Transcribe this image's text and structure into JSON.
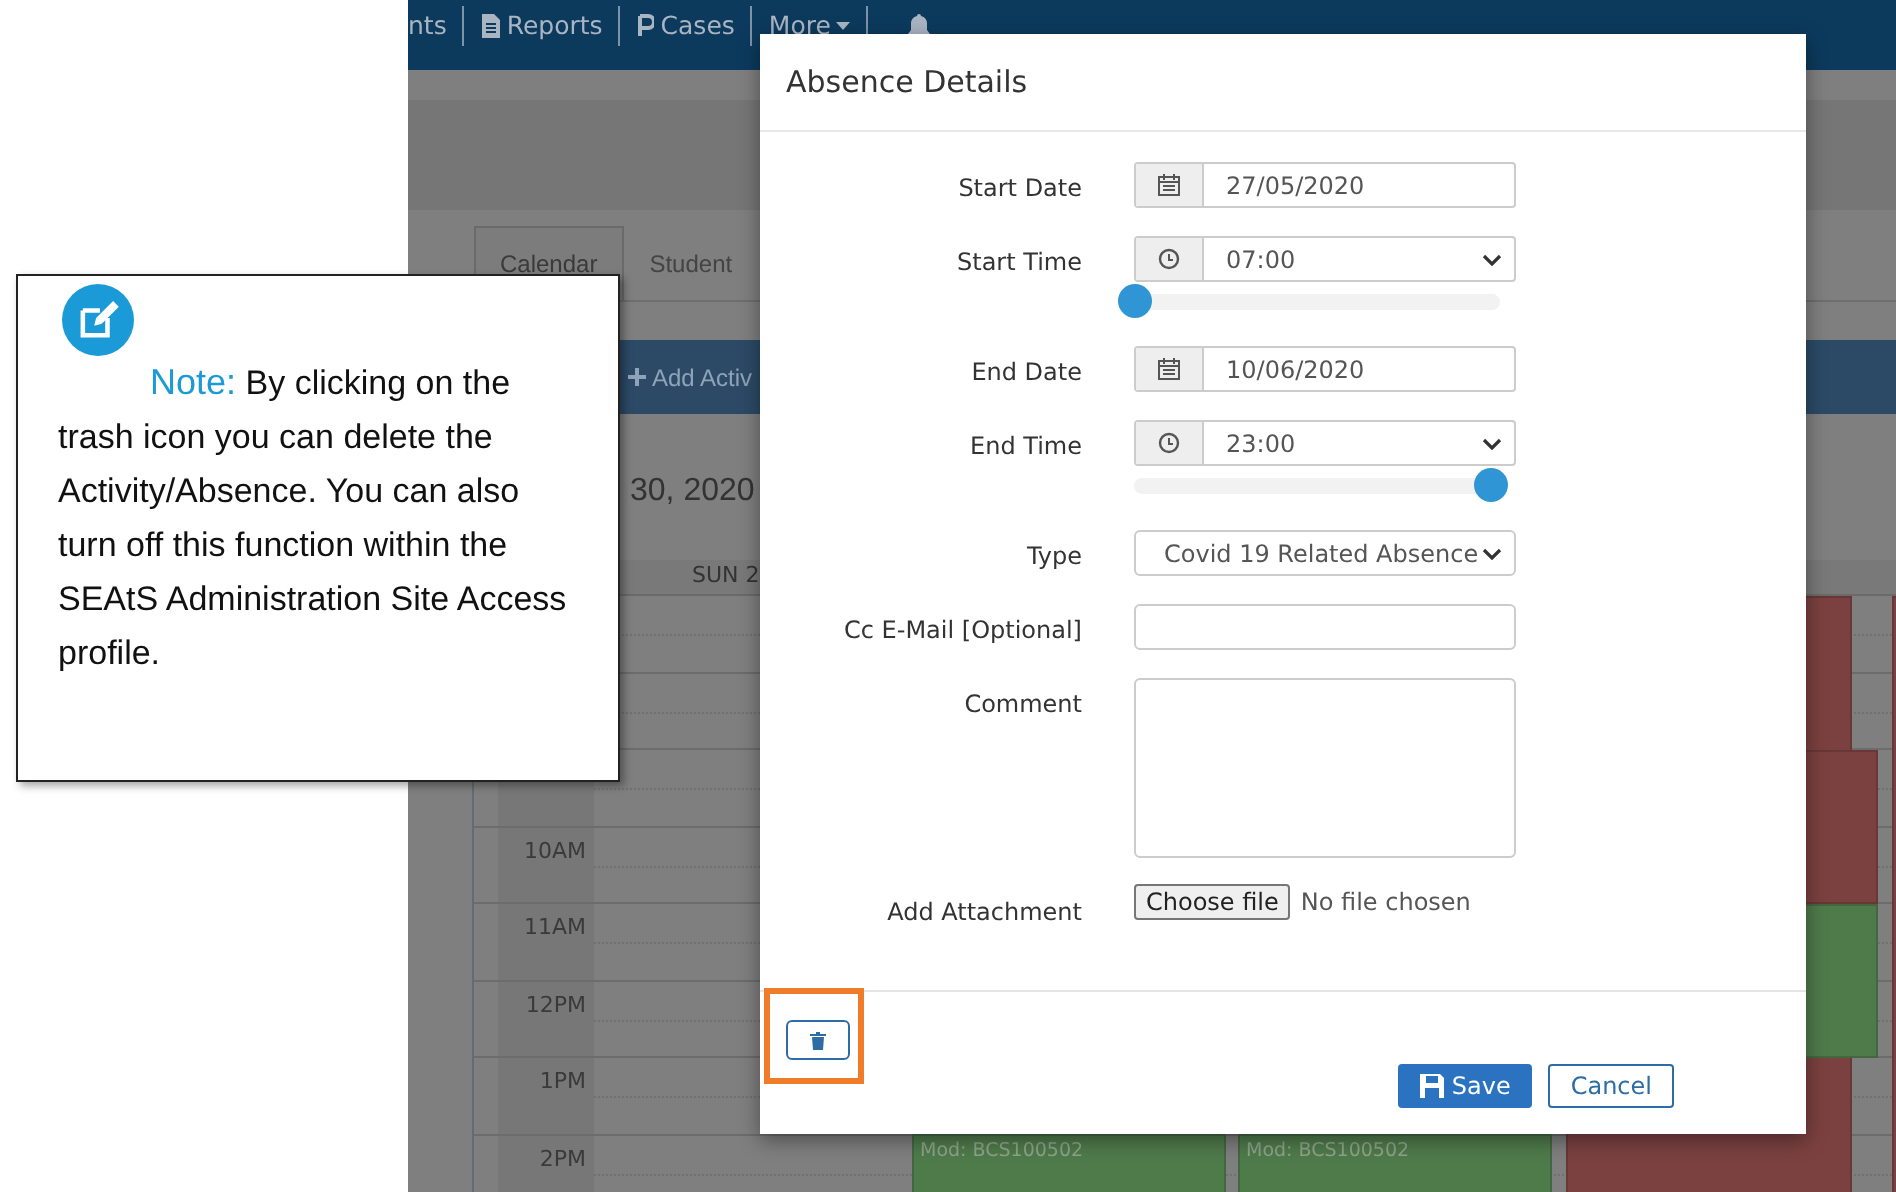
{
  "app_nav": {
    "items": [
      {
        "label": "nts",
        "kind": "plain"
      },
      {
        "label": "Reports",
        "kind": "document"
      },
      {
        "label": "Cases",
        "kind": "cases"
      },
      {
        "label": "More",
        "kind": "dropdown"
      }
    ]
  },
  "calendar": {
    "tabs": [
      {
        "label": "Calendar",
        "selected": true
      },
      {
        "label": "Student",
        "selected": false
      }
    ],
    "add_button": "Add Activ",
    "date_heading": "30, 2020",
    "day_header": "SUN 2",
    "time_labels": [
      "10AM",
      "11AM",
      "12PM",
      "1PM",
      "2PM"
    ],
    "events": [
      {
        "text": "Mod: BCS100502",
        "color": "#4f7b4b"
      },
      {
        "text": "Mod: BCS100502",
        "color": "#4f7b4b"
      },
      {
        "color": "#7b4140"
      },
      {
        "color": "#7b4140"
      },
      {
        "color": "#4f7b4b"
      },
      {
        "color": "#7b4140"
      }
    ]
  },
  "modal": {
    "title": "Absence Details",
    "fields": [
      {
        "kind": "date",
        "label": "Start Date",
        "value": "27/05/2020"
      },
      {
        "kind": "time",
        "label": "Start Time",
        "value": "07:00",
        "level": 0
      },
      {
        "kind": "date",
        "label": "End Date",
        "value": "10/06/2020"
      },
      {
        "kind": "time",
        "label": "End Time",
        "value": "23:00",
        "level": 1
      },
      {
        "kind": "select",
        "label": "Type",
        "value": "Covid 19 Related Absence"
      },
      {
        "kind": "text",
        "label": "Cc E-Mail [Optional]"
      },
      {
        "kind": "textarea",
        "label": "Comment"
      },
      {
        "kind": "file",
        "label": "Add Attachment",
        "button": "Choose file",
        "status": "No file chosen"
      }
    ],
    "delete_highlighted": true,
    "buttons": [
      {
        "label": "Save",
        "kind": "primary"
      },
      {
        "label": "Cancel",
        "kind": "default"
      }
    ]
  },
  "note": {
    "label": "Note:",
    "text": "By clicking on the trash icon you can delete the Activity/Absence. You can also turn off this function within the SEAtS Administration Site Access profile."
  }
}
